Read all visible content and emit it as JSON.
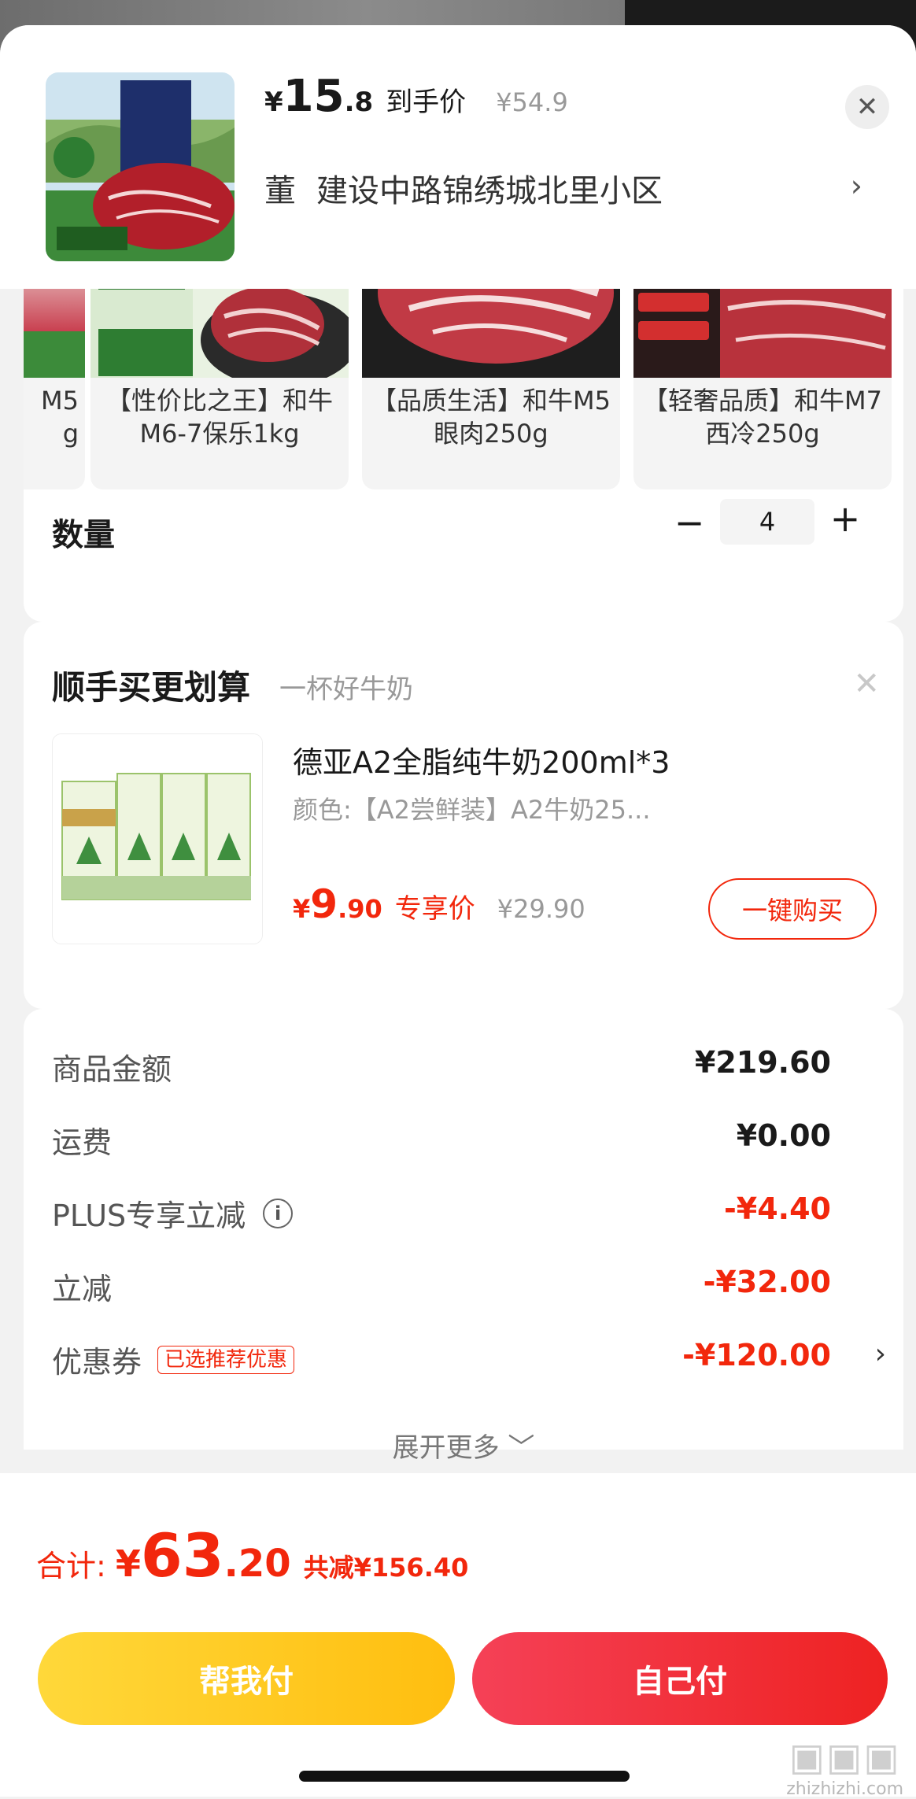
{
  "product": {
    "price_currency": "¥",
    "price_int": "15",
    "price_dec": ".8",
    "price_tag": "到手价",
    "original_price": "¥54.9",
    "address_name": "董",
    "address": "建设中路锦绣城北里小区",
    "thumb_icon": "beef-product-image"
  },
  "skus": [
    {
      "name": "M5\ng"
    },
    {
      "name": "【性价比之王】和牛M6-7保乐1kg"
    },
    {
      "name": "【品质生活】和牛M5眼肉250g"
    },
    {
      "name": "【轻奢品质】和牛M7西冷250g"
    }
  ],
  "quantity": {
    "label": "数量",
    "minus": "−",
    "value": "4",
    "plus": "+"
  },
  "addon": {
    "title": "顺手买更划算",
    "subtitle": "一杯好牛奶",
    "name": "德亚A2全脂纯牛奶200ml*3",
    "spec": "颜色:【A2尝鲜装】A2牛奶25...",
    "price_currency": "¥",
    "price_int": "9",
    "price_dec": ".90",
    "price_tag": "专享价",
    "original_price": "¥29.90",
    "buy_label": "一键购买"
  },
  "summary": {
    "rows": [
      {
        "label": "商品金额",
        "value": "¥219.60"
      },
      {
        "label": "运费",
        "value": "¥0.00"
      },
      {
        "label": "PLUS专享立减",
        "value": "-¥4.40"
      },
      {
        "label": "立减",
        "value": "-¥32.00"
      },
      {
        "label": "优惠券",
        "badge": "已选推荐优惠",
        "value": "-¥120.00"
      }
    ],
    "expand_label": "展开更多 ﹀"
  },
  "footer": {
    "total_label": "合计:",
    "total_currency": "¥",
    "total_int": "63",
    "total_dec": ".20",
    "saved": "共减¥156.40",
    "help_pay": "帮我付",
    "self_pay": "自己付"
  },
  "watermark": {
    "text": "zhizhizhi.com"
  },
  "colors": {
    "accent": "#f2270c",
    "help_btn": "#ffc81f",
    "pay_btn": "#f03a45"
  }
}
